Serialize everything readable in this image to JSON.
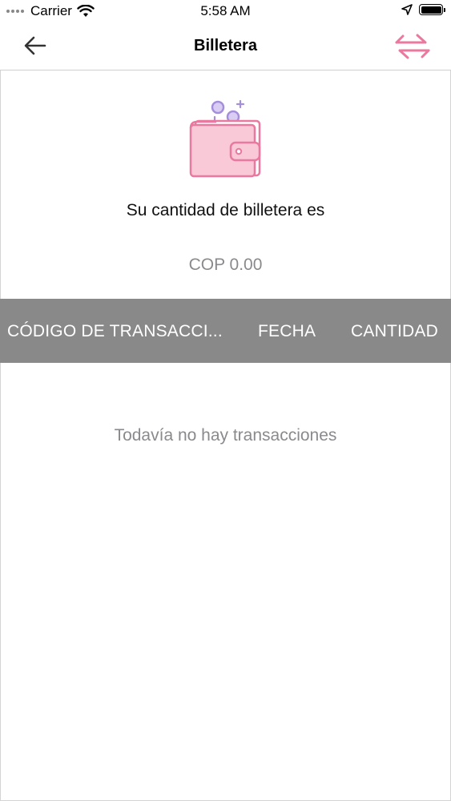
{
  "status_bar": {
    "carrier": "Carrier",
    "time": "5:58 AM",
    "icons": [
      "signal-dots-icon",
      "wifi-icon",
      "location-arrow-icon",
      "battery-icon"
    ]
  },
  "nav": {
    "title": "Billetera",
    "back_icon": "arrow-left-icon",
    "action_icon": "swap-arrows-icon"
  },
  "wallet": {
    "icon": "wallet-coins-icon",
    "label": "Su cantidad de billetera es",
    "amount": "COP 0.00"
  },
  "table": {
    "columns": [
      "CÓDIGO DE TRANSACCI...",
      "FECHA",
      "CANTIDAD"
    ],
    "rows": []
  },
  "empty_message": "Todavía no hay transacciones",
  "colors": {
    "accent_pink": "#e9799e",
    "wallet_fill": "#f9c9d8",
    "coin_purple": "#a58fdc",
    "header_gray": "#8a898a",
    "muted_text": "#8a8a8e"
  }
}
